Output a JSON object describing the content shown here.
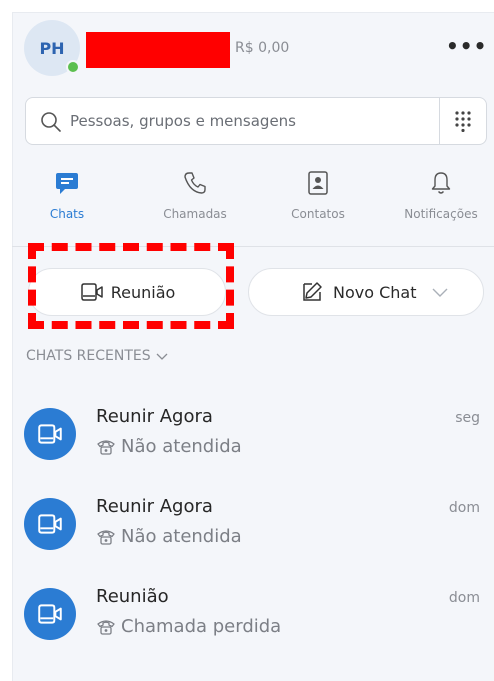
{
  "header": {
    "initials": "PH",
    "credit": "R$ 0,00",
    "more": "•••"
  },
  "search": {
    "placeholder": "Pessoas, grupos e mensagens"
  },
  "nav": [
    {
      "label": "Chats",
      "icon": "chat-icon",
      "active": true
    },
    {
      "label": "Chamadas",
      "icon": "phone-icon"
    },
    {
      "label": "Contatos",
      "icon": "contacts-icon"
    },
    {
      "label": "Notificações",
      "icon": "bell-icon"
    }
  ],
  "actions": {
    "meeting_label": "Reunião",
    "new_chat_label": "Novo Chat"
  },
  "section": {
    "title": "CHATS RECENTES"
  },
  "chats": [
    {
      "title": "Reunir Agora",
      "subtitle": "Não atendida",
      "time": "seg"
    },
    {
      "title": "Reunir Agora",
      "subtitle": "Não atendida",
      "time": "dom"
    },
    {
      "title": "Reunião",
      "subtitle": "Chamada perdida",
      "time": "dom"
    }
  ],
  "colors": {
    "accent": "#2b7cd3",
    "online": "#5cbf4f",
    "annotation": "#ff0000"
  }
}
